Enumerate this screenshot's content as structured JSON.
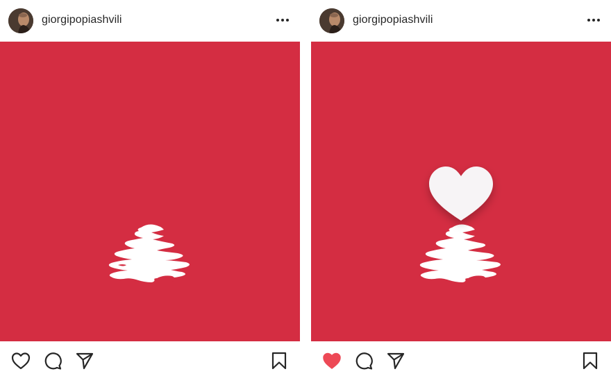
{
  "posts": [
    {
      "username": "giorgipopiashvili",
      "liked": false,
      "image": {
        "background_color": "#d42d42",
        "content": "white puddle"
      },
      "actions": {
        "like_icon": "heart-outline-icon",
        "comment_icon": "comment-icon",
        "share_icon": "paper-plane-icon",
        "save_icon": "bookmark-icon"
      }
    },
    {
      "username": "giorgipopiashvili",
      "liked": true,
      "image": {
        "background_color": "#d42d42",
        "content": "white heart over white puddle"
      },
      "actions": {
        "like_icon": "heart-filled-icon",
        "comment_icon": "comment-icon",
        "share_icon": "paper-plane-icon",
        "save_icon": "bookmark-icon"
      }
    }
  ],
  "colors": {
    "accent_red": "#d42d42",
    "like_red": "#ed4956",
    "text": "#262626"
  }
}
